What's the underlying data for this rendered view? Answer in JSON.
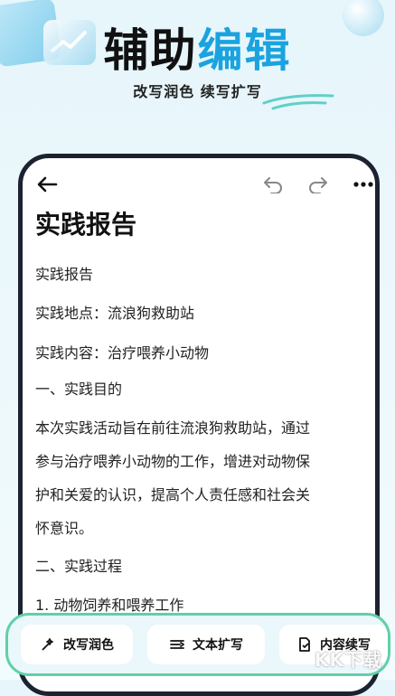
{
  "hero": {
    "title_part1": "辅助",
    "title_part2": "编辑",
    "subtitle": "改写润色 续写扩写"
  },
  "icons": {
    "back": "arrow-left-icon",
    "undo": "undo-icon",
    "redo": "redo-icon",
    "more": "more-dots-icon",
    "tool1": "wand-icon",
    "tool2": "expand-icon",
    "tool3": "continue-doc-icon"
  },
  "document": {
    "title": "实践报告",
    "lines": [
      "实践报告",
      "实践地点：流浪狗救助站",
      "实践内容：治疗喂养小动物",
      "一、实践目的"
    ],
    "paragraph_lines": [
      "本次实践活动旨在前往流浪狗救助站，通过",
      "参与治疗喂养小动物的工作，增进对动物保",
      "护和关爱的认识，提高个人责任感和社会关",
      "怀意识。"
    ],
    "section2": "二、实践过程",
    "section2_item1": "1. 动物饲养和喂养工作"
  },
  "toolbar": {
    "btn1": "改写润色",
    "btn2": "文本扩写",
    "btn3": "内容续写"
  },
  "watermark": "KK下载",
  "colors": {
    "accent": "#1aa3df",
    "toolbar_border": "#5fd0a7",
    "phone_frame": "#1c2230"
  }
}
